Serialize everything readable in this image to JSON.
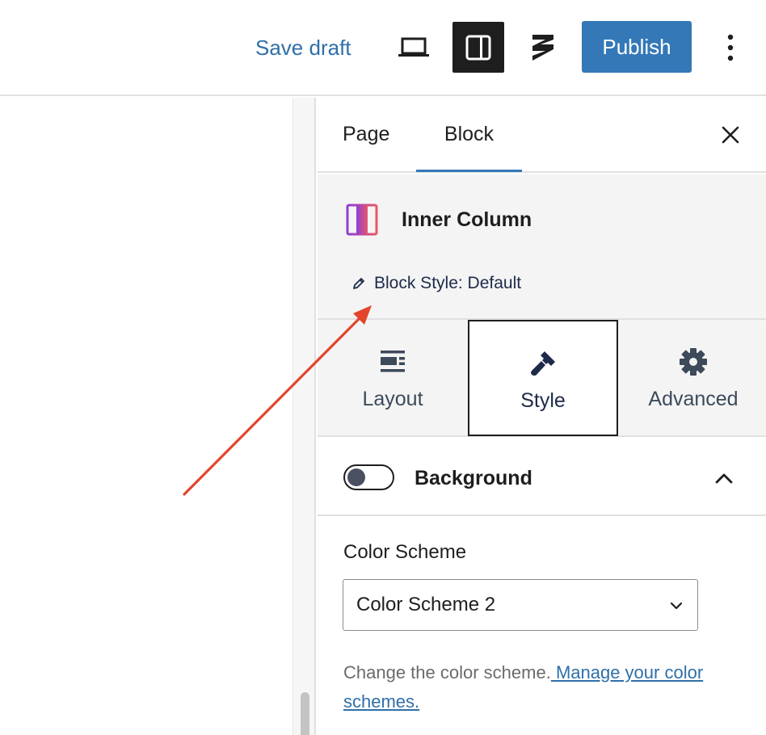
{
  "toolbar": {
    "save_draft_label": "Save draft",
    "publish_label": "Publish",
    "icons": [
      "laptop-icon",
      "settings-sidebar-icon",
      "stackable-icon",
      "more-vertical-icon"
    ]
  },
  "sidebar": {
    "tabs": [
      {
        "label": "Page",
        "active": false
      },
      {
        "label": "Block",
        "active": true
      }
    ],
    "block": {
      "title": "Inner Column",
      "style_label": "Block Style: Default"
    },
    "segments": [
      {
        "label": "Layout",
        "icon": "layout-icon",
        "active": false
      },
      {
        "label": "Style",
        "icon": "brush-icon",
        "active": true
      },
      {
        "label": "Advanced",
        "icon": "gear-icon",
        "active": false
      }
    ],
    "background": {
      "title": "Background",
      "enabled": false
    },
    "color_scheme": {
      "label": "Color Scheme",
      "selected": "Color Scheme 2",
      "help_text": "Change the color scheme.",
      "link_text": " Manage your color schemes."
    }
  },
  "colors": {
    "accent": "#3478b8",
    "annotation_arrow": "#e2452c"
  }
}
